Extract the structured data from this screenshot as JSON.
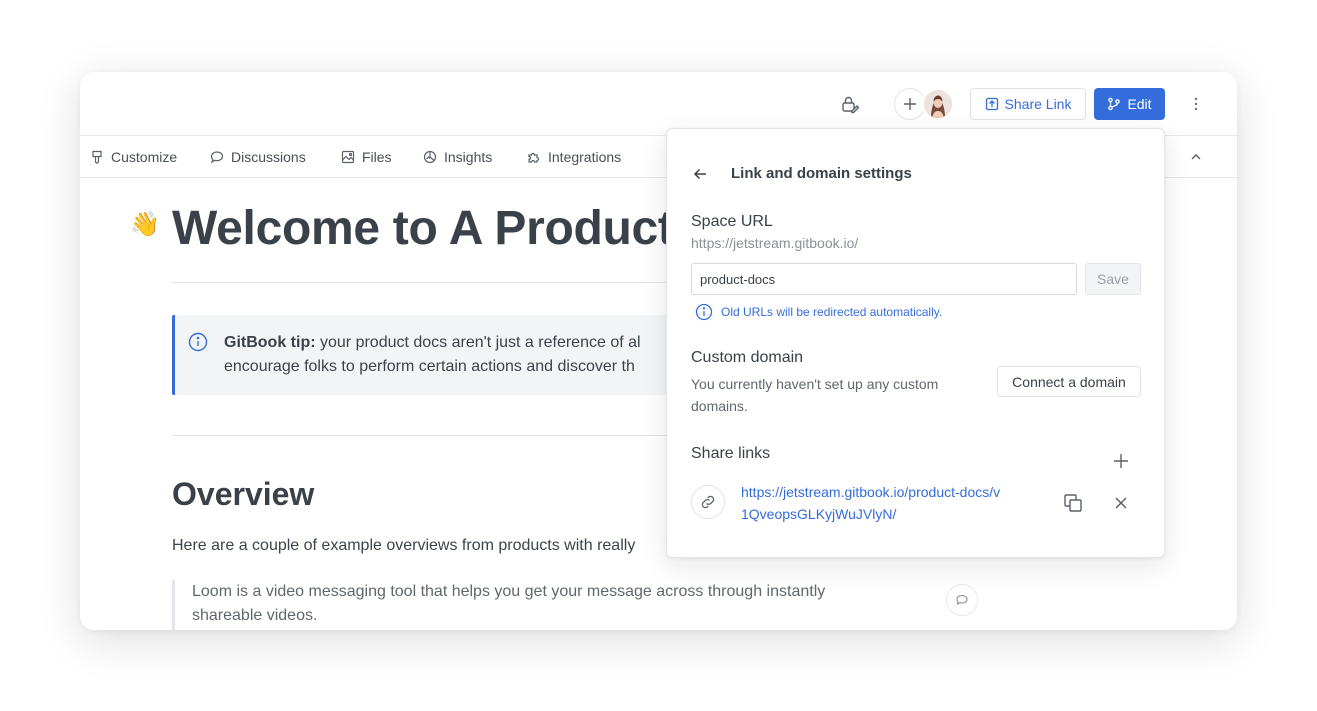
{
  "toolbar": {
    "share_label": "Share Link",
    "edit_label": "Edit"
  },
  "tabs": [
    {
      "label": "Customize",
      "icon": "brush-icon"
    },
    {
      "label": "Discussions",
      "icon": "chat-bubble-icon"
    },
    {
      "label": "Files",
      "icon": "image-icon"
    },
    {
      "label": "Insights",
      "icon": "chart-icon"
    },
    {
      "label": "Integrations",
      "icon": "puzzle-icon"
    }
  ],
  "content": {
    "emoji": "👋",
    "title": "Welcome to A Product",
    "hint_bold": "GitBook tip:",
    "hint_line1": " your product docs aren't just a reference of al",
    "hint_line2": "encourage folks to perform certain actions and discover th",
    "overview_heading": "Overview",
    "overview_text": "Here are a couple of example overviews from products with really",
    "quote": "Loom is a video messaging tool that helps you get your message across through instantly shareable videos."
  },
  "popover": {
    "title": "Link and domain settings",
    "space_url_label": "Space URL",
    "url_prefix": "https://jetstream.gitbook.io/",
    "url_slug": "product-docs",
    "save_label": "Save",
    "redirect_note": "Old URLs will be redirected automatically.",
    "custom_domain_label": "Custom domain",
    "custom_domain_desc": "You currently haven't set up any custom domains.",
    "connect_label": "Connect a domain",
    "share_links_label": "Share links",
    "share_link_url": "https://jetstream.gitbook.io/product-docs/v1QveopsGLKyjWuJVlyN/"
  },
  "colors": {
    "accent": "#346ddb",
    "text": "#3d434b",
    "muted": "#8b9096"
  }
}
